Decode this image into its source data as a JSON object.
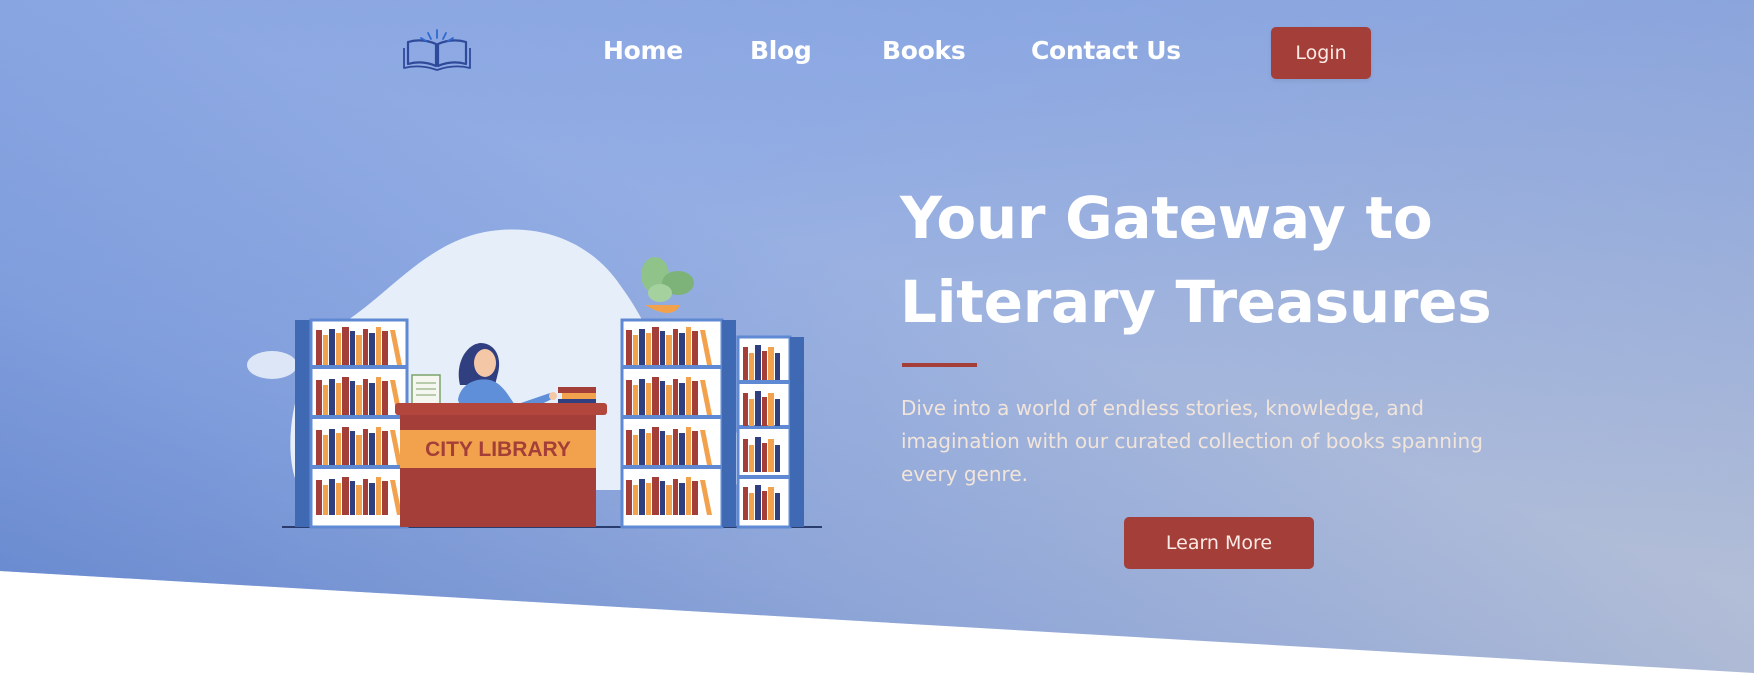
{
  "nav": {
    "logo_icon": "open-book-icon",
    "links": [
      "Home",
      "Blog",
      "Books",
      "Contact Us"
    ],
    "login_label": "Login"
  },
  "hero": {
    "title_line1": "Your Gateway to",
    "title_line2": "Literary Treasures",
    "description": "Dive into a world of endless stories, knowledge, and imagination with our curated collection of books spanning every genre.",
    "cta_label": "Learn More",
    "illustration": {
      "desk_sign": "CITY LIBRARY"
    }
  },
  "colors": {
    "accent": "#a33f38",
    "hero_gradient_start": "#8aa6e2",
    "hero_gradient_end": "#b5bfd6",
    "shelf_blue": "#4a77c4",
    "book_orange": "#f2a24c",
    "book_navy": "#2f3f80"
  }
}
